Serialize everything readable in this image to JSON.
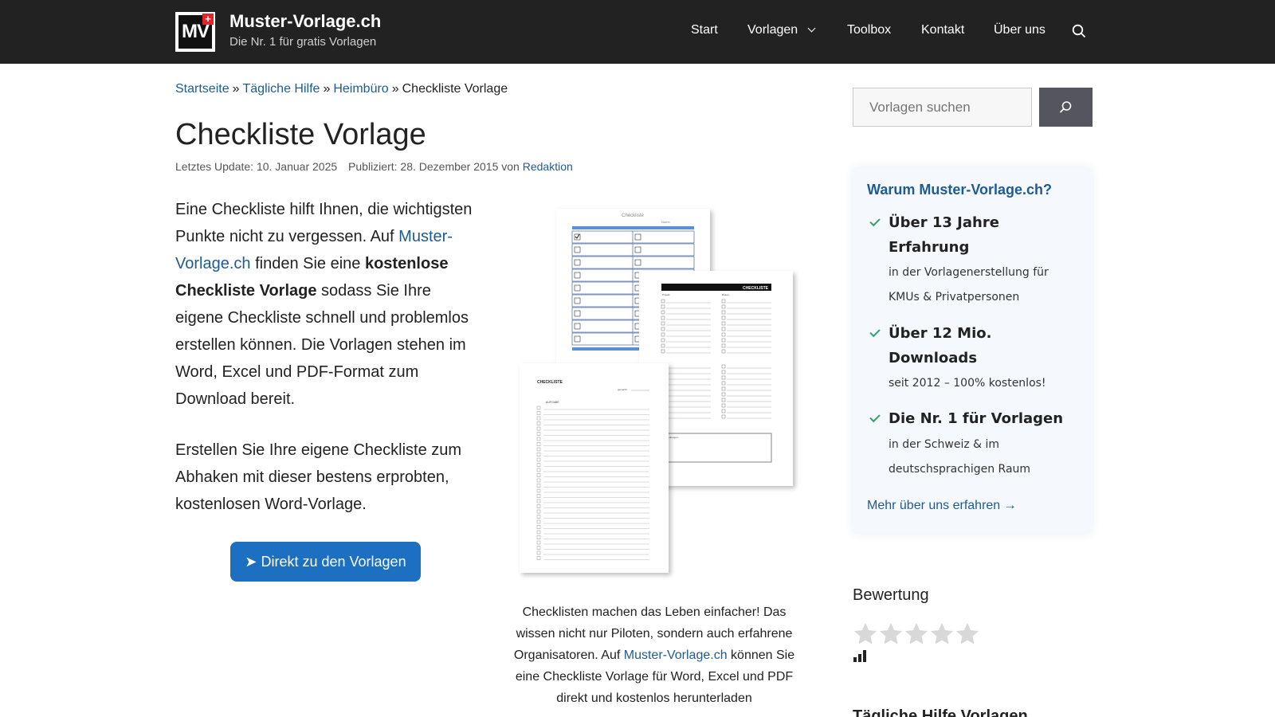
{
  "header": {
    "logo_text": "MV",
    "logo_flag": "+",
    "site_title": "Muster-Vorlage.ch",
    "tagline": "Die Nr. 1 für gratis Vorlagen",
    "nav": [
      {
        "label": "Start"
      },
      {
        "label": "Vorlagen",
        "has_dropdown": true
      },
      {
        "label": "Toolbox"
      },
      {
        "label": "Kontakt"
      },
      {
        "label": "Über uns"
      }
    ],
    "search_icon": "search-icon"
  },
  "breadcrumb": {
    "items": [
      "Startseite",
      "Tägliche Hilfe",
      "Heimbüro"
    ],
    "separator": "»",
    "current": "Checkliste Vorlage"
  },
  "article": {
    "title": "Checkliste Vorlage",
    "updated": "Letztes Update: 10. Januar 2025",
    "published": "Publiziert: 28. Dezember 2015 von",
    "author": "Redaktion",
    "intro": {
      "p1": "Eine Checkliste hilft Ihnen, die wichtigsten Punkte nicht zu vergessen. Auf ",
      "link": "Muster-Vorlage.ch",
      "p2": " finden Sie eine ",
      "bold": "kostenlose Checkliste Vorlage",
      "p3": " sodass Sie Ihre eigene Checkliste schnell und problemlos erstellen können. Die Vorlagen stehen im Word, Excel und PDF-Format zum Download bereit."
    },
    "intro2": "Erstellen Sie Ihre eigene Checkliste zum Abhaken mit dieser bestens erprobten, kostenlosen Word-Vorlage.",
    "cta_label": "➤ Direkt zu den Vorlagen",
    "image_texts": {
      "doc1_title": "Checkliste",
      "doc1_name": "Name:",
      "doc2_title": "CHECKLISTE",
      "doc2_col1": "Projekt:",
      "doc2_col2": "Datum:",
      "doc2_notes": "Bemerkungen:",
      "doc3_title": "CHECKLISTE",
      "doc3_sub": "AUFGABE",
      "doc3_right": "gemacht:"
    },
    "caption": {
      "before": "Checklisten machen das Leben einfacher! Das wissen nicht nur Piloten, sondern auch erfahrene Organisatoren. Auf ",
      "link": "Muster-Vorlage.ch",
      "after": " können Sie eine Checkliste Vorlage für Word, Excel und PDF direkt und kostenlos herunterladen"
    }
  },
  "sidebar": {
    "search_placeholder": "Vorlagen suchen",
    "why": {
      "title": "Warum Muster-Vorlage.ch?",
      "items": [
        {
          "head": "Über 13 Jahre Erfahrung",
          "sub": "in der Vorlagenerstellung für KMUs & Privatpersonen"
        },
        {
          "head": "Über 12 Mio. Downloads",
          "sub": "seit 2012 – 100% kostenlos!"
        },
        {
          "head": "Die Nr. 1 für Vorlagen",
          "sub": "in der Schweiz & im deutschsprachigen Raum"
        }
      ],
      "more": "Mehr über uns erfahren →"
    },
    "rating_title": "Bewertung",
    "rating": {
      "stars_total": 5,
      "stars_filled": 0
    },
    "next_section": "Tägliche Hilfe Vorlagen"
  },
  "colors": {
    "header_bg": "#222222",
    "link": "#1e5b94",
    "cta": "#1d6fc1",
    "check": "#2fa36b",
    "box_bg": "#f5f8fd"
  }
}
